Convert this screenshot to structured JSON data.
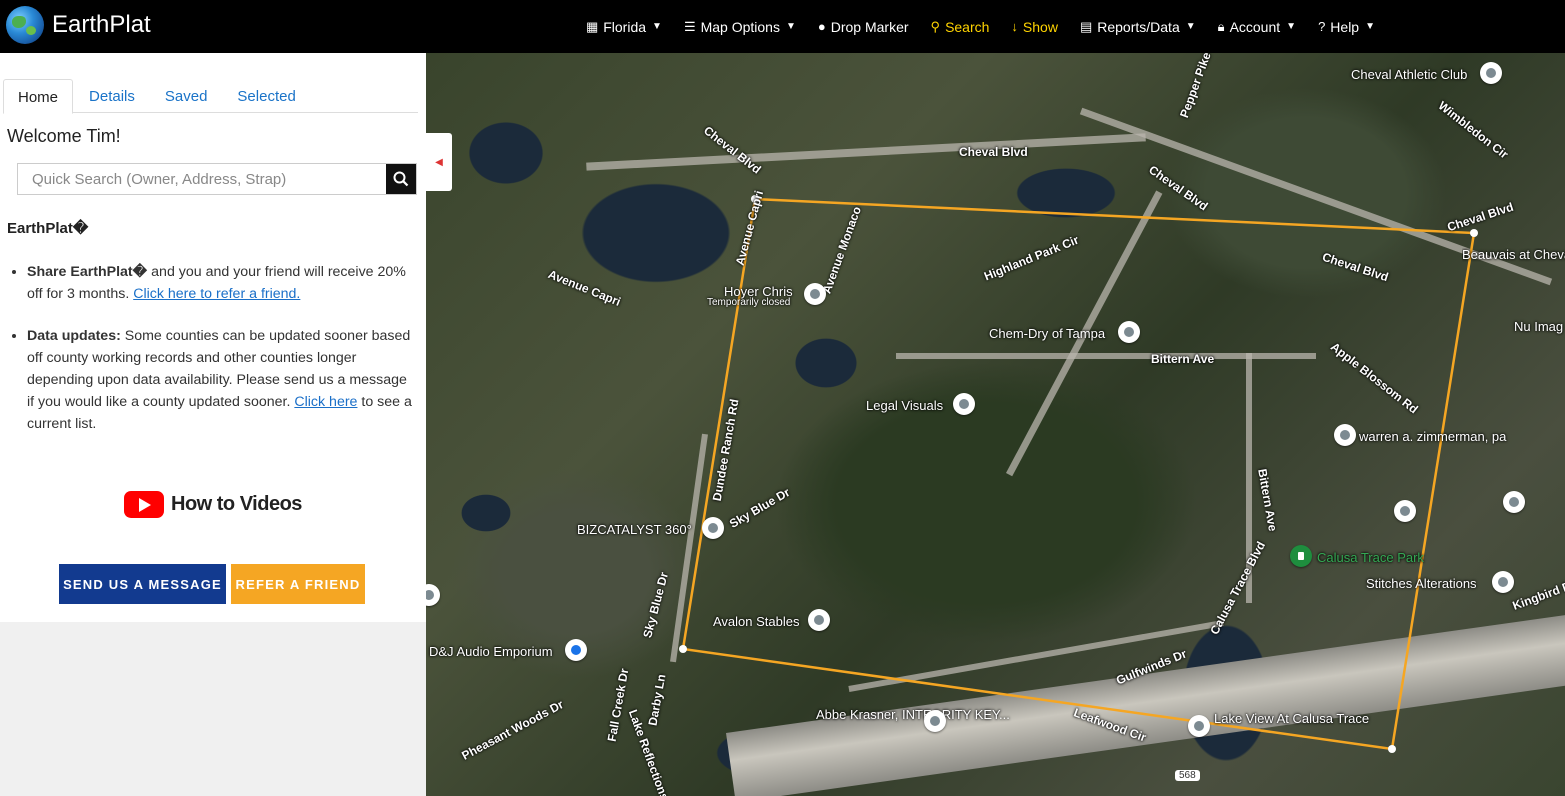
{
  "brand": {
    "name": "EarthPlat"
  },
  "nav": {
    "items": [
      {
        "label": "Florida",
        "icon": "map-icon",
        "dropdown": true
      },
      {
        "label": "Map Options",
        "icon": "sliders-icon",
        "dropdown": true
      },
      {
        "label": "Drop Marker",
        "icon": "marker-icon",
        "dropdown": false
      },
      {
        "label": "Search",
        "icon": "search-icon",
        "dropdown": false,
        "highlight": true
      },
      {
        "label": "Show",
        "icon": "arrow-down-icon",
        "dropdown": false,
        "highlight": true
      },
      {
        "label": "Reports/Data",
        "icon": "table-icon",
        "dropdown": true
      },
      {
        "label": "Account",
        "icon": "lock-icon",
        "dropdown": true
      },
      {
        "label": "Help",
        "icon": "help-icon",
        "dropdown": true
      }
    ]
  },
  "sidebar": {
    "tabs": [
      "Home",
      "Details",
      "Saved",
      "Selected"
    ],
    "active_tab": "Home",
    "welcome": "Welcome Tim!",
    "search": {
      "placeholder": "Quick Search (Owner, Address, Strap)"
    },
    "heading": "EarthPlat�",
    "bullet1": {
      "bold": "Share EarthPlat�",
      "text": " and you and your friend will receive 20% off for 3 months. ",
      "link": "Click here to refer a friend."
    },
    "bullet2": {
      "bold": "Data updates:",
      "text": " Some counties can be updated sooner based off county working records and other counties longer depending upon data availability. Please send us a message if you would like a county updated sooner. ",
      "link": "Click here",
      "after": " to see a current list."
    },
    "videos_label": "How to Videos",
    "send_message": "SEND US A MESSAGE",
    "refer_friend": "REFER A FRIEND"
  },
  "map": {
    "streets": [
      "Cheval Blvd",
      "Cheval Blvd",
      "Cheval Blvd",
      "Cheval Blvd",
      "Cheval Blvd",
      "Avenue Capri",
      "Avenue Capri",
      "Avenue Monaco",
      "Highland Park Cir",
      "Bittern Ave",
      "Bittern Ave",
      "Apple Blossom Rd",
      "Dundee Ranch Rd",
      "Sky Blue Dr",
      "Sky Blue Dr",
      "Calusa Trace Blvd",
      "Gulfwinds Dr",
      "Leafwood Cir",
      "Fall Creek Dr",
      "Lake Reflections",
      "Darby Ln",
      "Pheasant Woods Dr",
      "Pepper Pike",
      "Wimbledon Cir",
      "Kingbird Dr"
    ],
    "places": [
      "Cheval Athletic Club",
      "Hoyer Chris",
      "Temporarily closed",
      "Chem-Dry of Tampa",
      "Beauvais at Cheval - Taylor Morrison",
      "Nu Imag",
      "Legal Visuals",
      "warren a. zimmerman, pa",
      "BIZCATALYST 360°",
      "Calusa Trace Park",
      "Stitches Alterations",
      "Avalon Stables",
      "D&J Audio Emporium",
      "Abbe Krasner, INTEGRITY KEY...",
      "Lake View At Calusa Trace"
    ],
    "road_number": "568",
    "polygon_color": "#f5a623"
  }
}
